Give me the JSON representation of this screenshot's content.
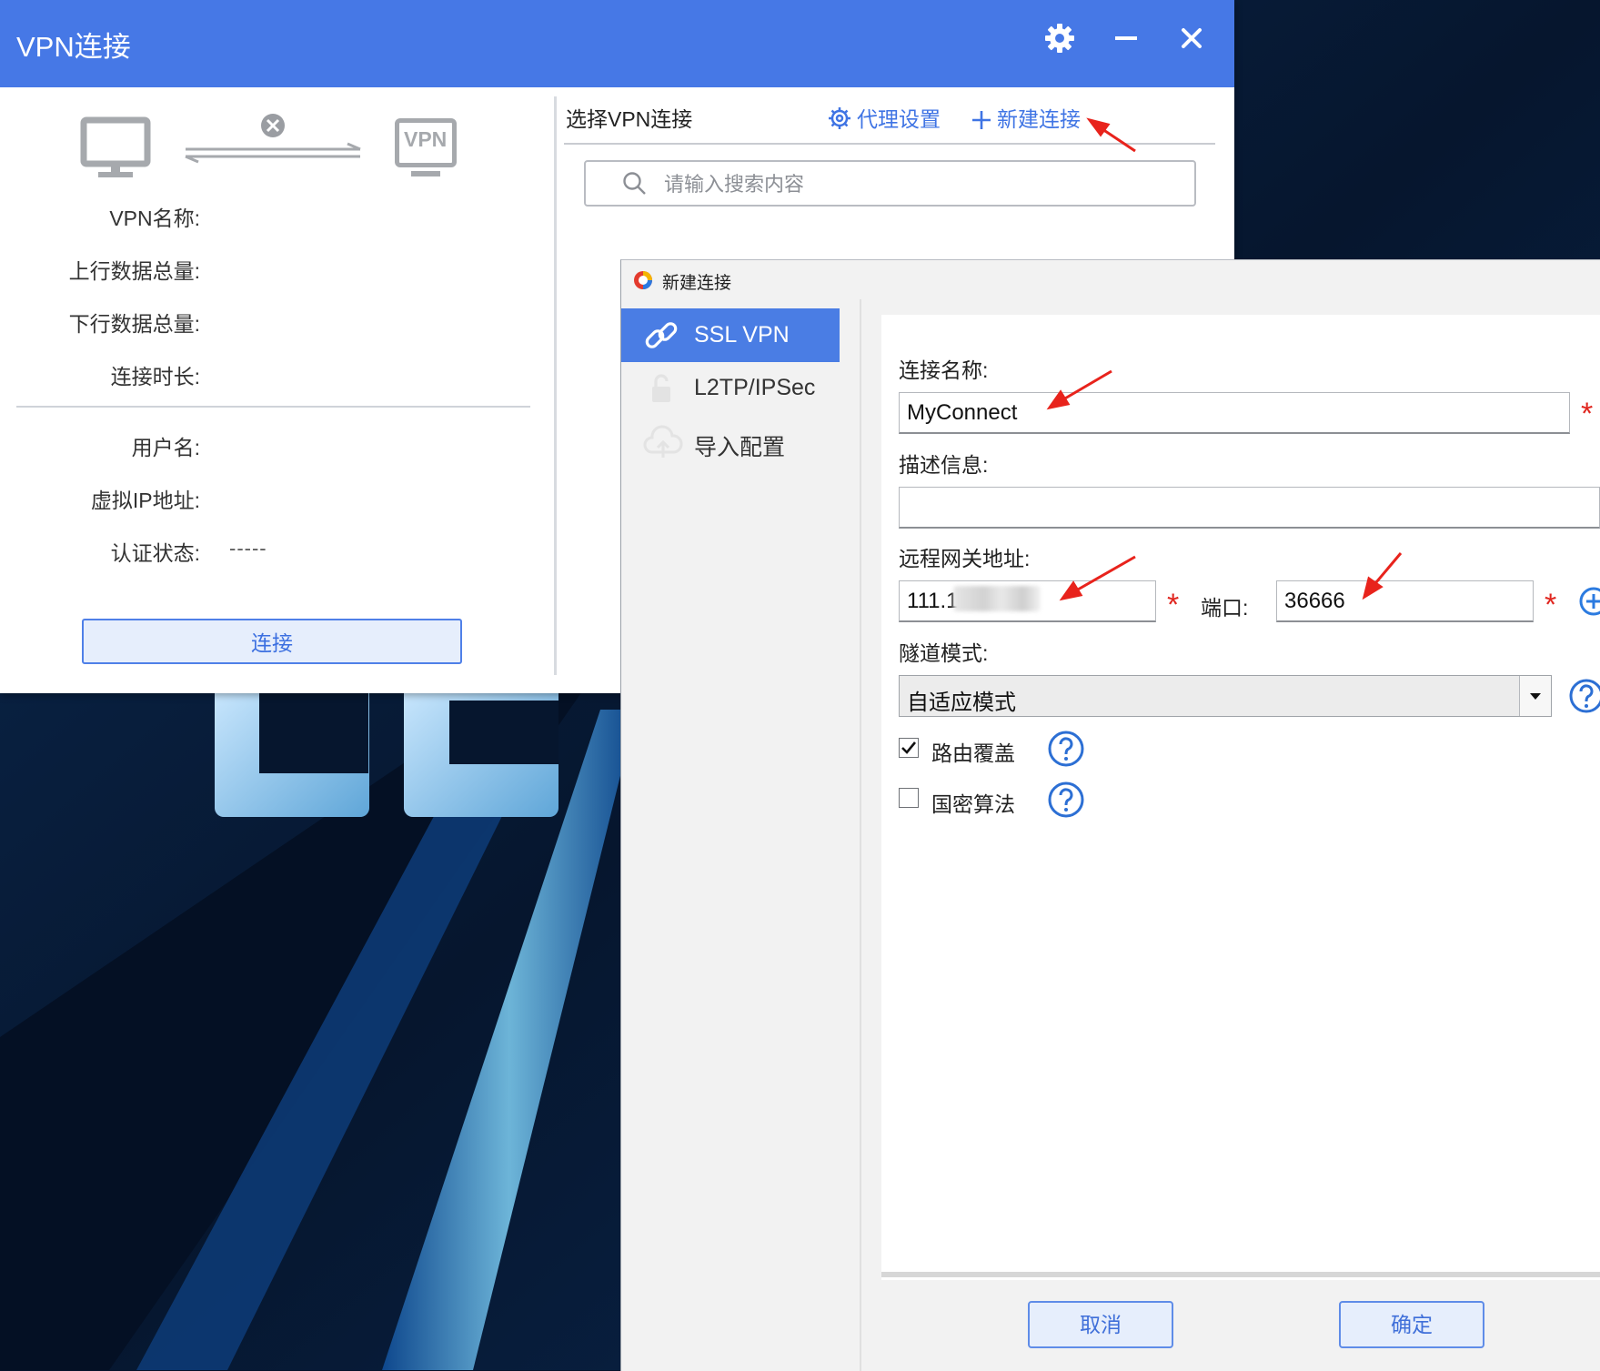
{
  "main_window": {
    "title": "VPN连接",
    "status_fields": {
      "vpn_name_label": "VPN名称:",
      "upload_label": "上行数据总量:",
      "download_label": "下行数据总量:",
      "duration_label": "连接时长:",
      "username_label": "用户名:",
      "virtual_ip_label": "虚拟IP地址:",
      "auth_status_label": "认证状态:",
      "auth_status_value": "-----"
    },
    "connect_button": "连接",
    "vpn_badge": "VPN",
    "list_panel": {
      "title": "选择VPN连接",
      "proxy_settings": "代理设置",
      "new_connection": "新建连接",
      "search_placeholder": "请输入搜索内容"
    }
  },
  "dialog": {
    "title": "新建连接",
    "sidebar": [
      {
        "label": "SSL VPN",
        "icon": "link-icon",
        "active": true
      },
      {
        "label": "L2TP/IPSec",
        "icon": "lock-icon",
        "active": false
      },
      {
        "label": "导入配置",
        "icon": "cloud-upload-icon",
        "active": false
      }
    ],
    "form": {
      "connection_name_label": "连接名称:",
      "connection_name_value": "MyConnect",
      "description_label": "描述信息:",
      "description_value": "",
      "gateway_label": "远程网关地址:",
      "gateway_value": "111.1",
      "port_label": "端口:",
      "port_value": "36666",
      "tunnel_mode_label": "隧道模式:",
      "tunnel_mode_value": "自适应模式",
      "route_override_label": "路由覆盖",
      "route_override_checked": true,
      "sm_algorithm_label": "国密算法",
      "sm_algorithm_checked": false,
      "required_mark": "*"
    },
    "buttons": {
      "cancel": "取消",
      "ok": "确定"
    }
  },
  "colors": {
    "titlebar_blue": "#4678e6",
    "accent_blue": "#3f74e4",
    "required_red": "#e0261f",
    "annotation_red": "#e8231c"
  }
}
